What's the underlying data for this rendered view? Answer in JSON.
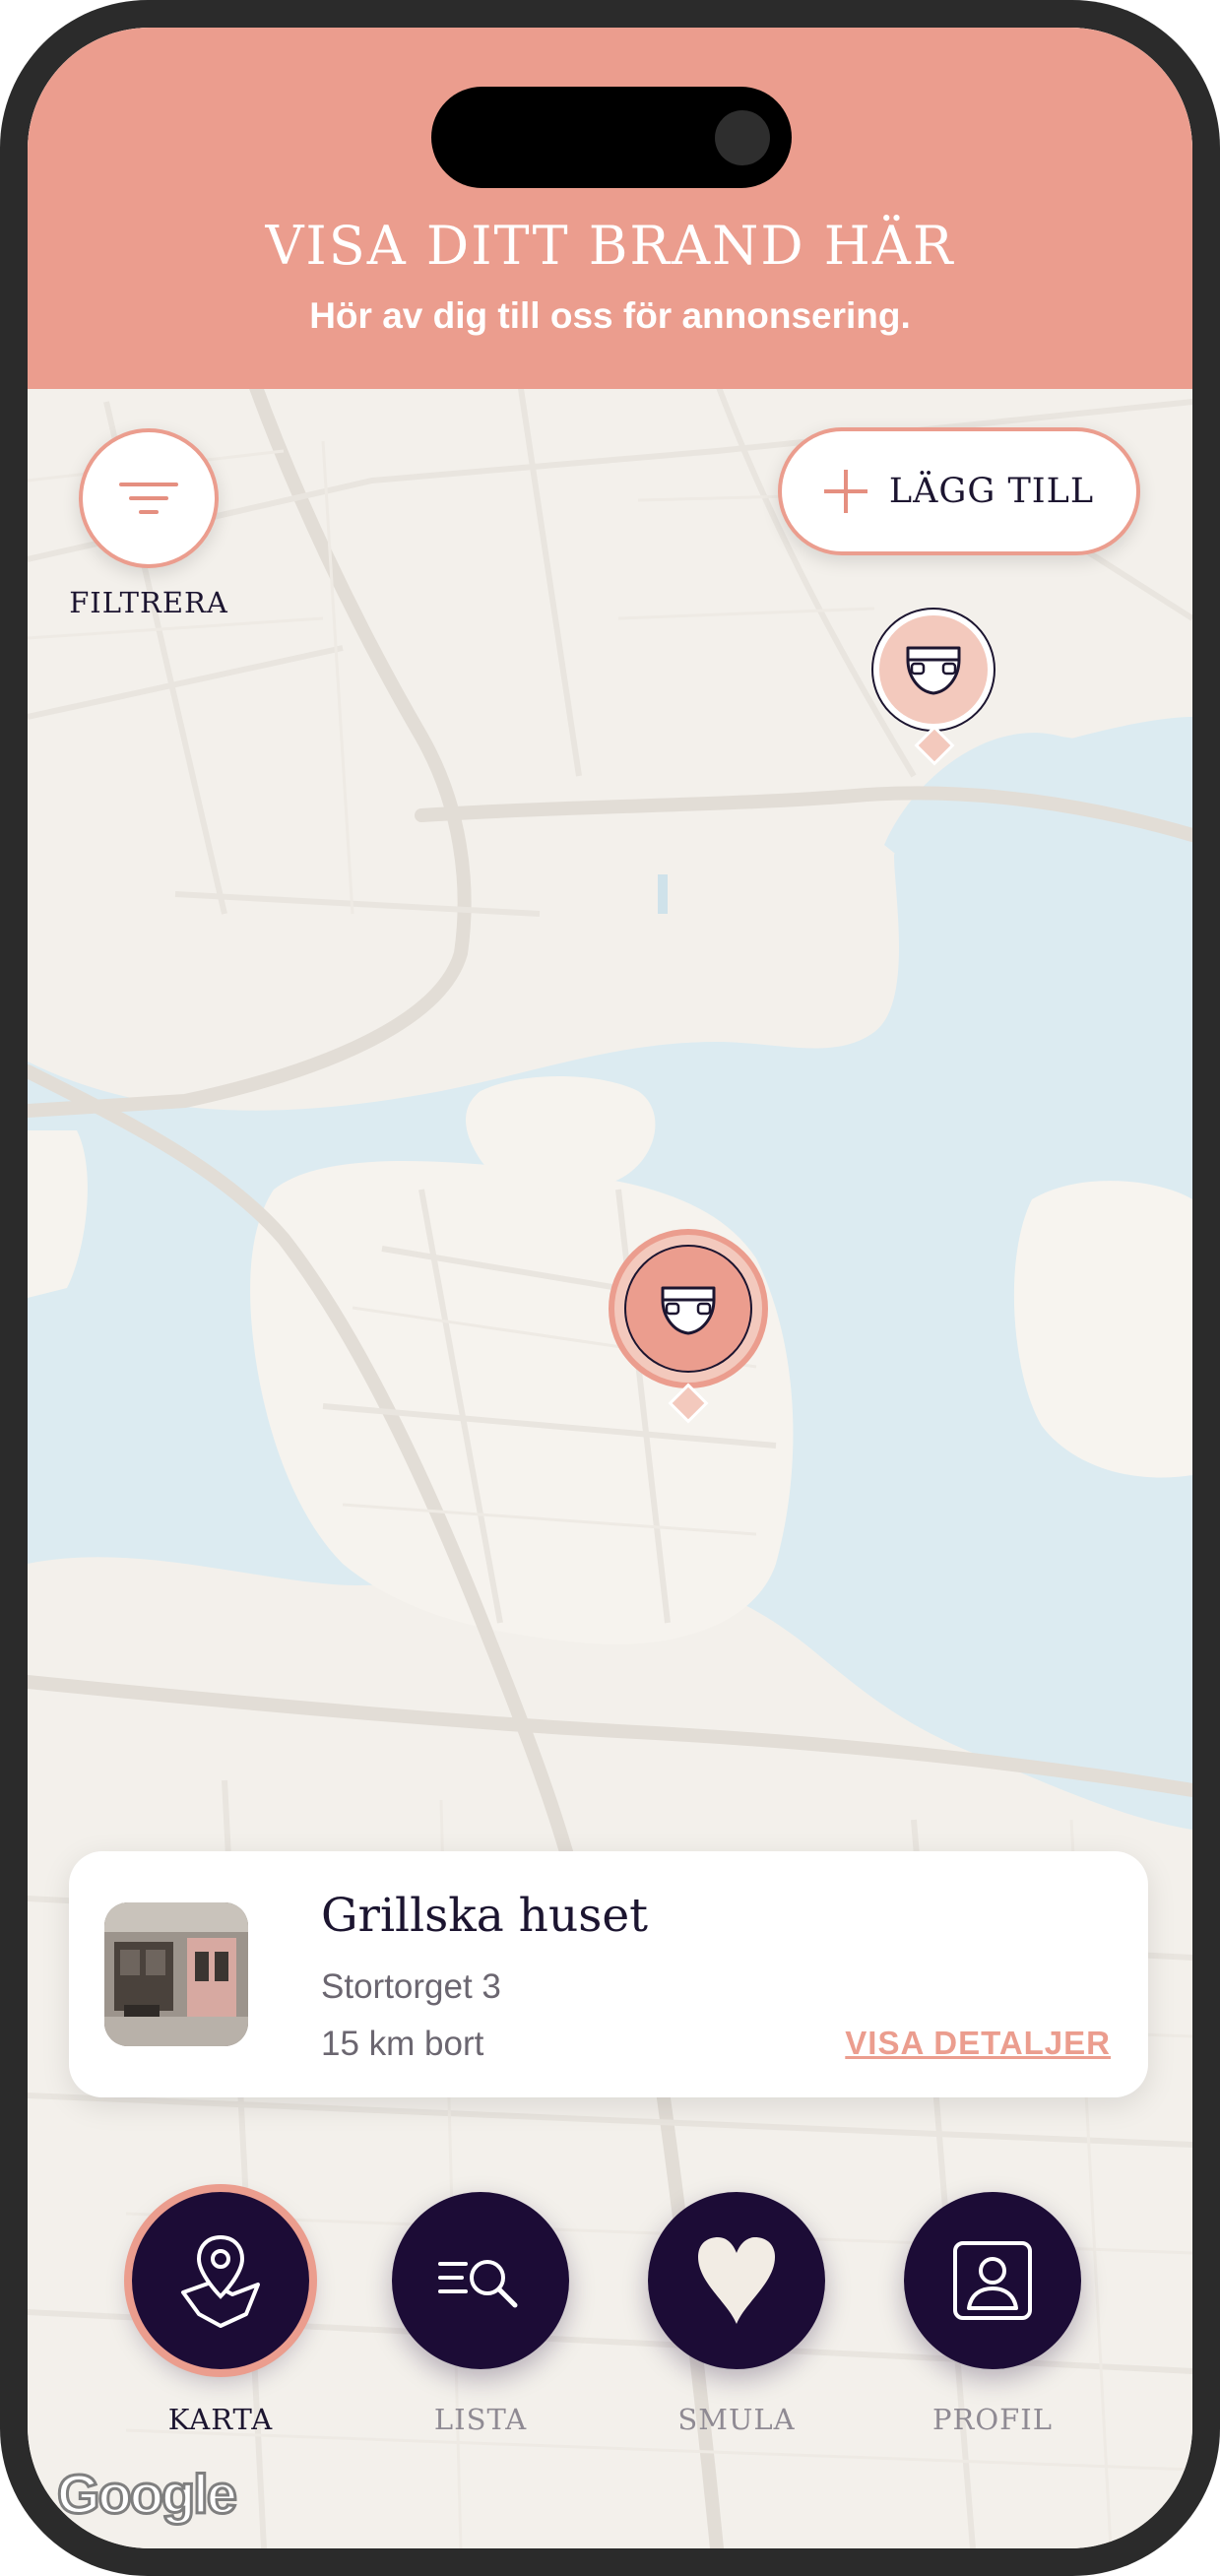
{
  "banner": {
    "title": "VISA DITT BRAND HÄR",
    "subtitle": "Hör av dig till oss för annonsering.",
    "color": "#eb9d8e"
  },
  "map_controls": {
    "filter_label": "FILTRERA",
    "filter_icon": "filter-icon",
    "add_label": "LÄGG TILL",
    "add_icon": "plus-icon"
  },
  "markers": [
    {
      "icon": "diaper-icon",
      "selected": false
    },
    {
      "icon": "diaper-icon",
      "selected": true
    }
  ],
  "place_card": {
    "title": "Grillska huset",
    "address": "Stortorget 3",
    "distance": "15 km bort",
    "details_link": "VISA DETALJER"
  },
  "nav": {
    "items": [
      {
        "label": "KARTA",
        "icon": "map-pin-icon",
        "active": true
      },
      {
        "label": "LISTA",
        "icon": "list-search-icon",
        "active": false
      },
      {
        "label": "SMULA",
        "icon": "heart-icon",
        "active": false
      },
      {
        "label": "PROFIL",
        "icon": "profile-icon",
        "active": false
      }
    ]
  },
  "map": {
    "attribution": "Google"
  },
  "colors": {
    "accent": "#eb9d8e",
    "nav_bg": "#1c0c36",
    "text_dark": "#1c1530",
    "water": "#dcebf1",
    "land": "#f3f0eb"
  }
}
